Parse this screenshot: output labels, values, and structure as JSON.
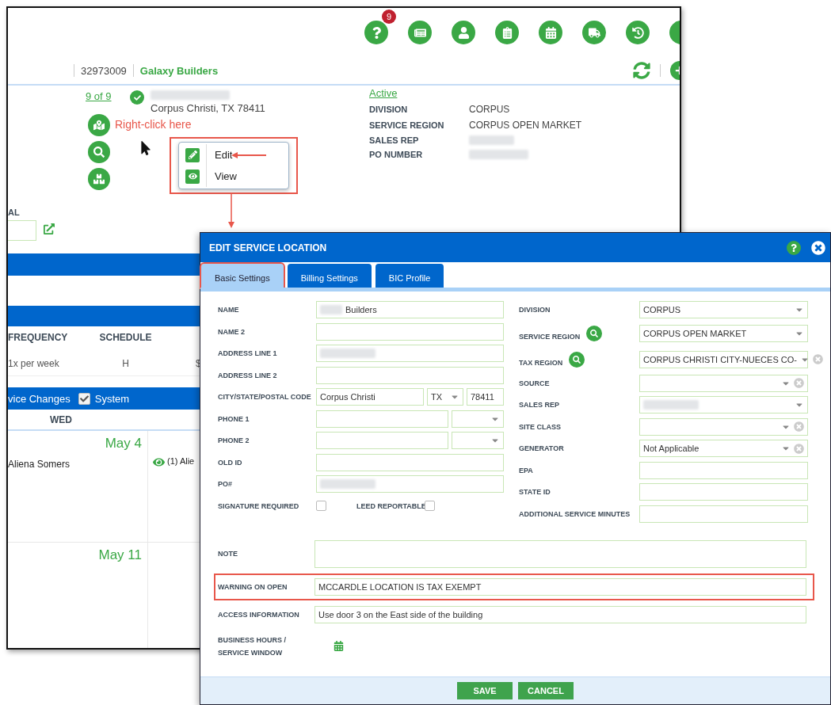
{
  "main_window": {
    "toolbar": [
      {
        "kind": "help",
        "badge": "9"
      },
      {
        "kind": "document"
      },
      {
        "kind": "person"
      },
      {
        "kind": "checklist"
      },
      {
        "kind": "calendar"
      },
      {
        "kind": "truck"
      },
      {
        "kind": "history"
      },
      {
        "kind": "more"
      }
    ],
    "account_number": "32973009",
    "account_name": "Galaxy Builders",
    "location": {
      "counter": "9 of 9",
      "address": "Corpus Christi, TX 78411",
      "status": "Active",
      "details": [
        {
          "label": "DIVISION",
          "value": "CORPUS"
        },
        {
          "label": "SERVICE REGION",
          "value": "CORPUS OPEN MARKET"
        },
        {
          "label": "SALES REP"
        },
        {
          "label": "PO NUMBER"
        }
      ]
    },
    "annotation": "Right-click here",
    "context_menu": {
      "highlighted": true,
      "items": [
        {
          "kind": "edit",
          "label": "Edit"
        },
        {
          "kind": "view",
          "label": "View"
        }
      ]
    },
    "partial_label": "AL",
    "services": {
      "columns": [
        "FREQUENCY",
        "SCHEDULE"
      ],
      "rows": [
        [
          "1x per week",
          "H",
          "$"
        ]
      ]
    },
    "filter_bar": {
      "label": "vice Changes",
      "system": {
        "label": "System",
        "checked": true
      }
    },
    "calendar": {
      "day": "WED",
      "weeks": [
        {
          "date": "May 4",
          "entry": "Aliena Somers",
          "next_entry": "(1) Alie"
        },
        {
          "date": "May 11"
        }
      ]
    }
  },
  "dialog": {
    "title": "EDIT SERVICE LOCATION",
    "tabs": [
      {
        "label": "Basic Settings",
        "selected": true,
        "highlighted": true
      },
      {
        "label": "Billing Settings",
        "selected": false,
        "highlighted": false
      },
      {
        "label": "BIC Profile",
        "selected": false,
        "highlighted": false
      }
    ],
    "left_fields": [
      {
        "kind": "text",
        "label": "NAME",
        "value": "Builders",
        "blurred_prefix": true
      },
      {
        "kind": "text",
        "label": "NAME 2"
      },
      {
        "kind": "text",
        "label": "ADDRESS LINE 1",
        "blurred": true
      },
      {
        "kind": "text",
        "label": "ADDRESS LINE 2"
      },
      {
        "kind": "city",
        "label": "CITY/STATE/POSTAL CODE",
        "values": [
          "Corpus Christi",
          "TX",
          "78411"
        ]
      },
      {
        "kind": "phone",
        "label": "PHONE 1"
      },
      {
        "kind": "phone",
        "label": "PHONE 2"
      },
      {
        "kind": "text",
        "label": "OLD ID"
      },
      {
        "kind": "text",
        "label": "PO#",
        "blurred": true
      },
      {
        "kind": "checks",
        "items": [
          {
            "label": "SIGNATURE REQUIRED",
            "checked": false
          },
          {
            "label": "LEED REPORTABLE",
            "checked": false
          }
        ]
      }
    ],
    "right_fields": [
      {
        "kind": "select",
        "label": "DIVISION",
        "value": "CORPUS",
        "search": false,
        "clearable": false
      },
      {
        "kind": "select",
        "label": "SERVICE REGION",
        "value": "CORPUS OPEN MARKET",
        "search": true,
        "clearable": false
      },
      {
        "kind": "select",
        "label": "TAX REGION",
        "value": "CORPUS CHRISTI CITY-NUECES CO-",
        "search": true,
        "clearable": true
      },
      {
        "kind": "select",
        "label": "SOURCE",
        "search": false,
        "clearable": true
      },
      {
        "kind": "select",
        "label": "SALES REP",
        "blurred": true,
        "search": false,
        "clearable": false
      },
      {
        "kind": "select",
        "label": "SITE CLASS",
        "search": false,
        "clearable": true
      },
      {
        "kind": "select",
        "label": "GENERATOR",
        "value": "Not Applicable",
        "search": false,
        "clearable": true
      },
      {
        "kind": "text",
        "label": "EPA"
      },
      {
        "kind": "text",
        "label": "STATE ID"
      },
      {
        "kind": "text",
        "label": "ADDITIONAL SERVICE MINUTES"
      }
    ],
    "wide_fields": [
      {
        "kind": "textarea",
        "label": "NOTE",
        "highlighted": false
      },
      {
        "kind": "text",
        "label": "WARNING ON OPEN",
        "value": "MCCARDLE LOCATION IS TAX EXEMPT",
        "highlighted": true
      },
      {
        "kind": "text",
        "label": "ACCESS INFORMATION",
        "value": "Use door 3 on the East side of the building",
        "highlighted": false
      },
      {
        "kind": "schedule",
        "label": "BUSINESS HOURS / SERVICE WINDOW",
        "highlighted": false
      }
    ],
    "buttons": [
      "SAVE",
      "CANCEL"
    ]
  }
}
